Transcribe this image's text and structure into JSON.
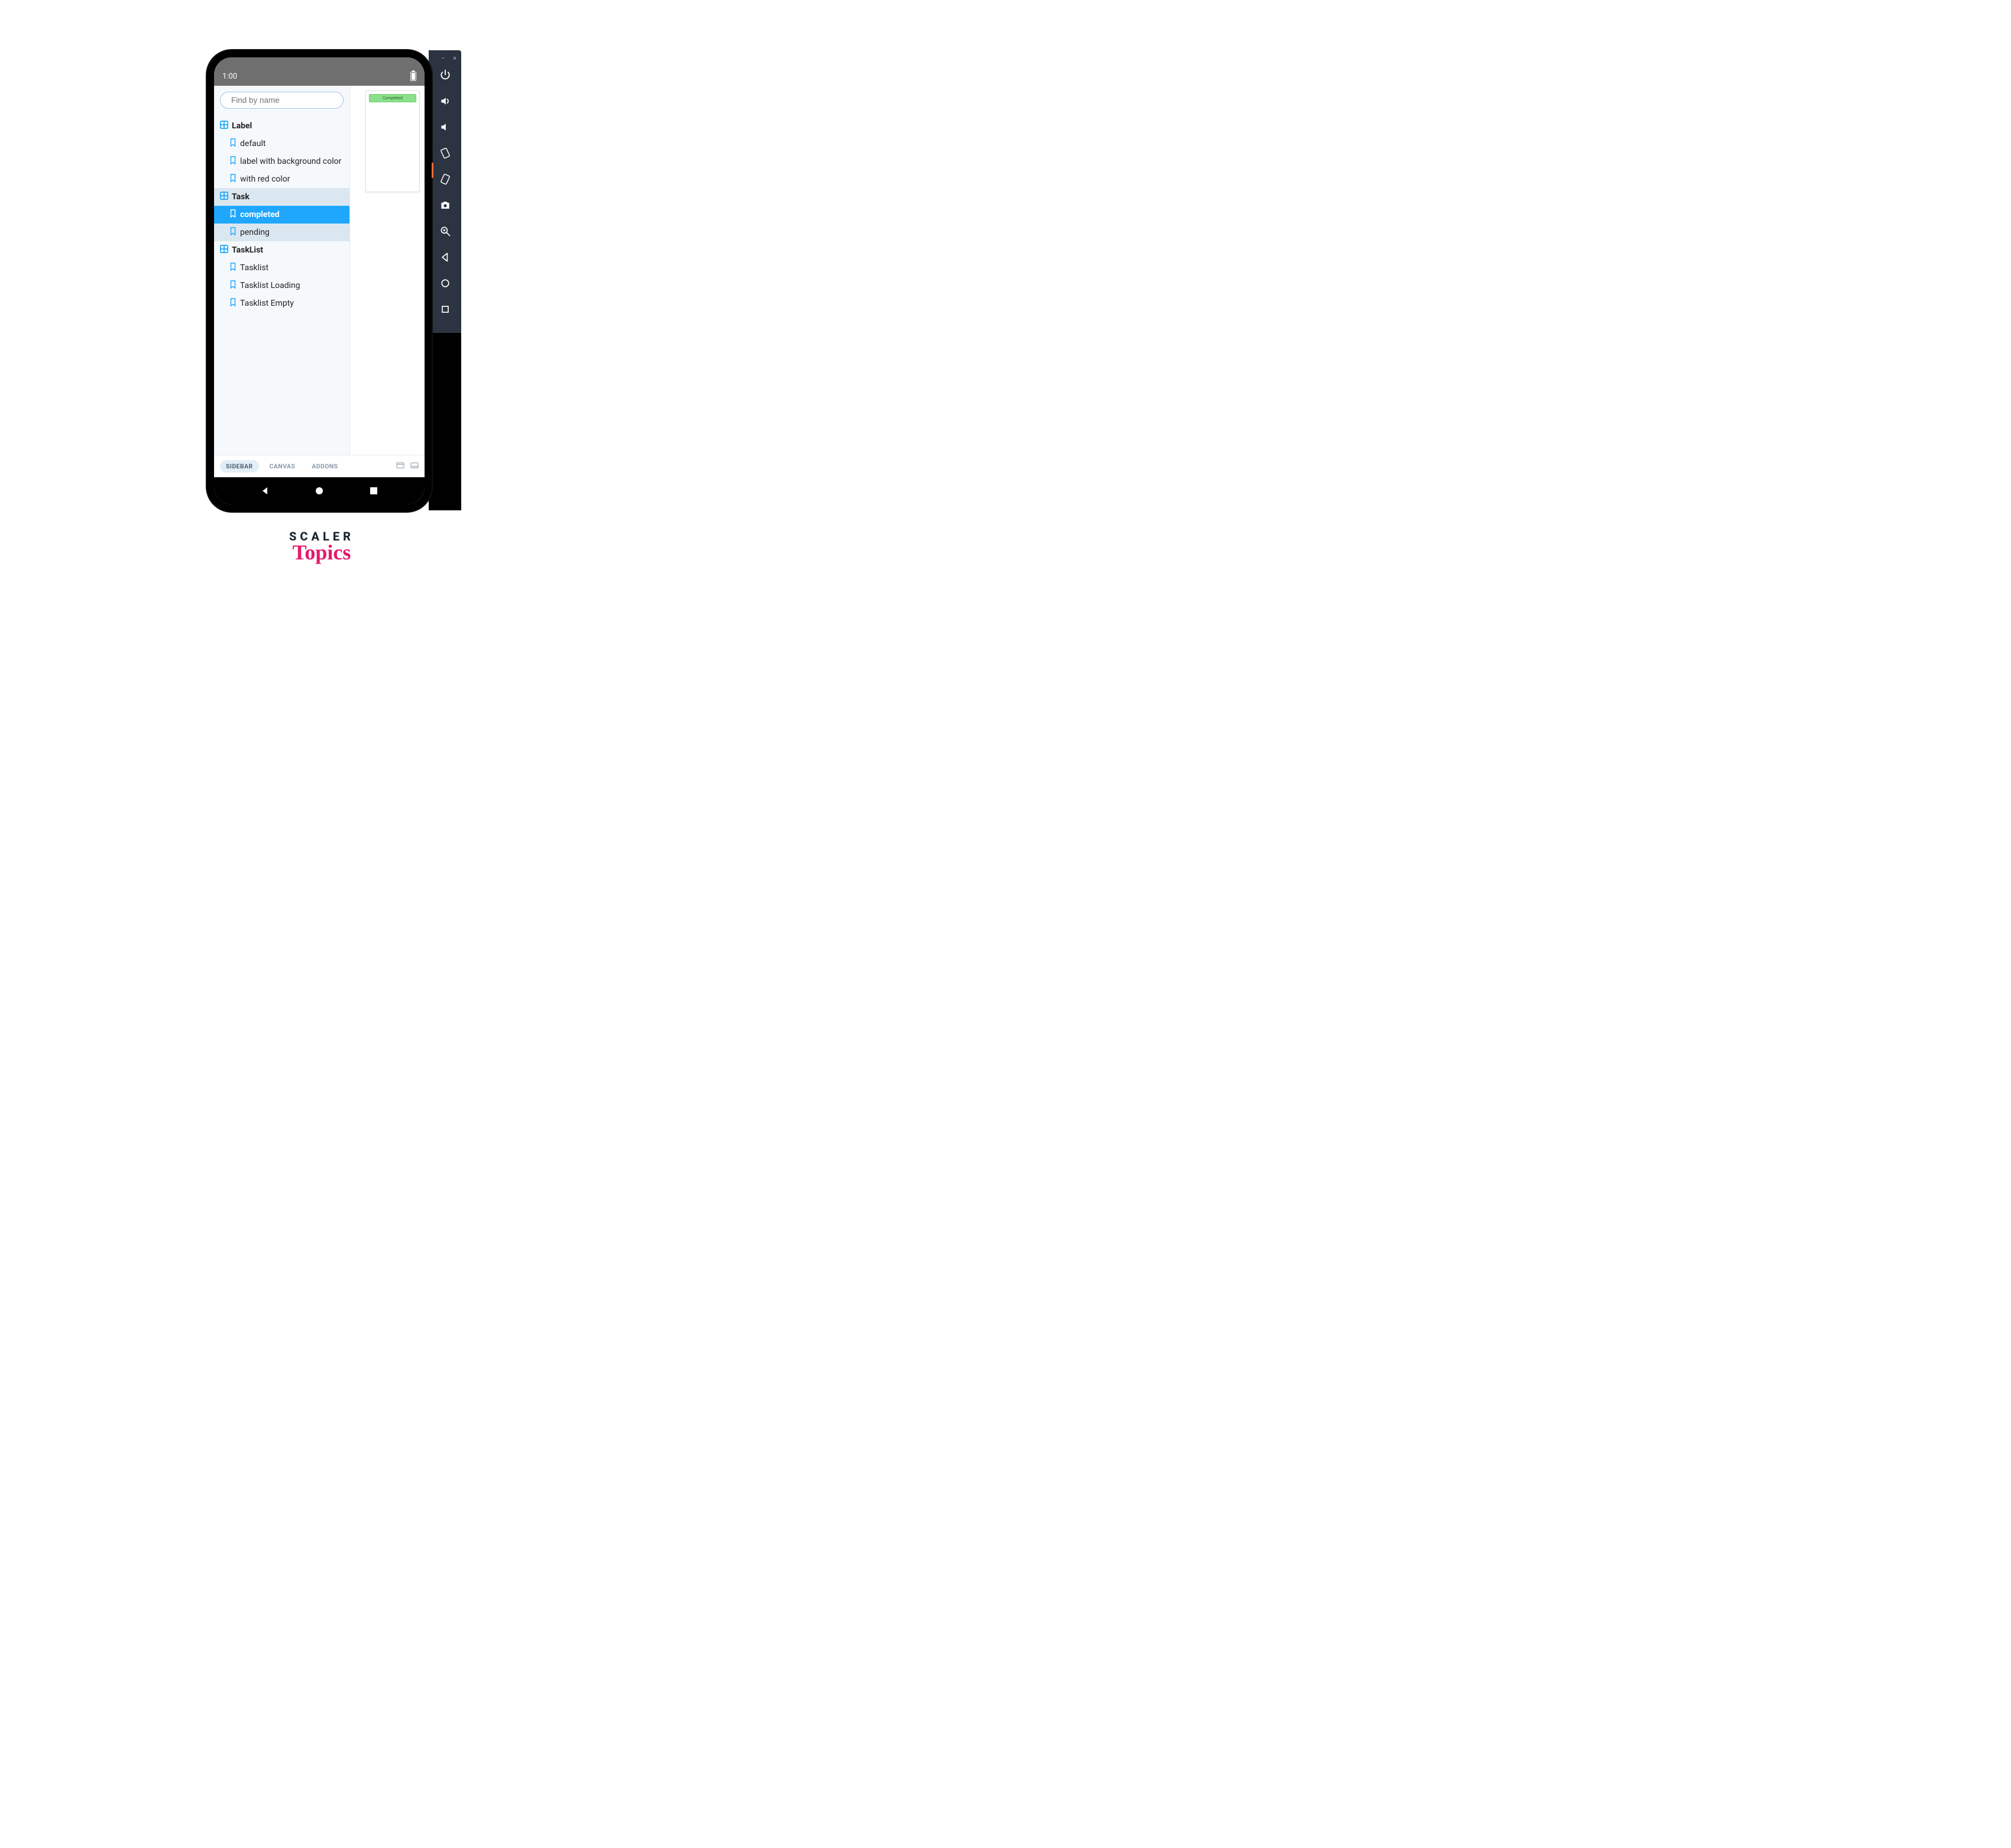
{
  "status": {
    "time": "1:00"
  },
  "search": {
    "placeholder": "Find by name"
  },
  "groups": {
    "label": {
      "title": "Label",
      "items": {
        "default": "default",
        "bg": "label with background color",
        "red": "with red color"
      }
    },
    "task": {
      "title": "Task",
      "items": {
        "completed": "completed",
        "pending": "pending"
      }
    },
    "tasklist": {
      "title": "TaskList",
      "items": {
        "list": "Tasklist",
        "loading": "Tasklist Loading",
        "empty": "Tasklist Empty"
      }
    }
  },
  "preview": {
    "badge": "Completed"
  },
  "tabs": {
    "sidebar": "SIDEBAR",
    "canvas": "CANVAS",
    "addons": "ADDONS"
  },
  "logo": {
    "line1": "SCALER",
    "line2": "Topics"
  },
  "emu": {
    "minimize": "−",
    "close": "×"
  }
}
